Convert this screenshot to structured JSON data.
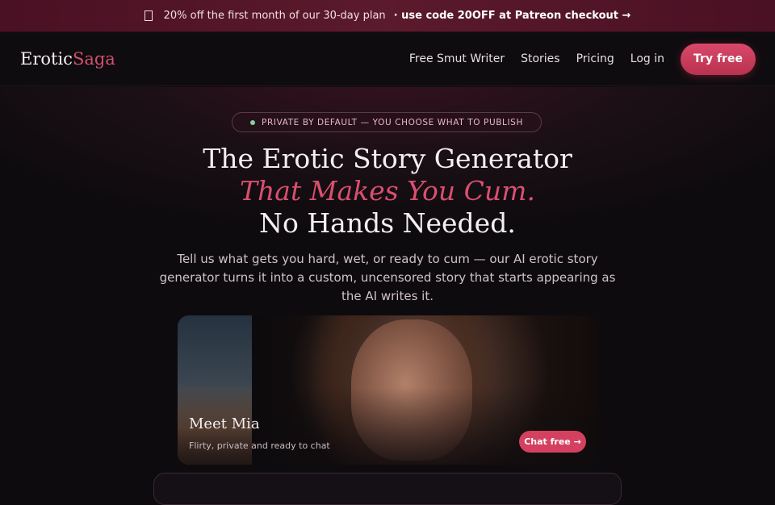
{
  "promo": {
    "icon": "gift-icon",
    "text": "20% off the first month of our 30-day plan",
    "cta": "· use code 20OFF at Patreon checkout →"
  },
  "nav": {
    "logo_main": "Erotic",
    "logo_accent": "Saga",
    "links": [
      "Free Smut Writer",
      "Stories",
      "Pricing",
      "Log in"
    ],
    "cta": "Try free"
  },
  "hero": {
    "badge": "PRIVATE BY DEFAULT — YOU CHOOSE WHAT TO PUBLISH",
    "title_line1": "The Erotic Story Generator",
    "title_line2": "That Makes You Cum.",
    "title_line3": "No Hands Needed.",
    "subtitle": "Tell us what gets you hard, wet, or ready to cum — our AI erotic story generator turns it into a custom, uncensored story that starts appearing as the AI writes it."
  },
  "character_card": {
    "name": "Meet Mia",
    "description": "Flirty, private and ready to chat",
    "button": "Chat free →"
  },
  "colors": {
    "accent": "#d4506e",
    "promo_bg": "#4a1023",
    "background": "#0e0b0e"
  }
}
